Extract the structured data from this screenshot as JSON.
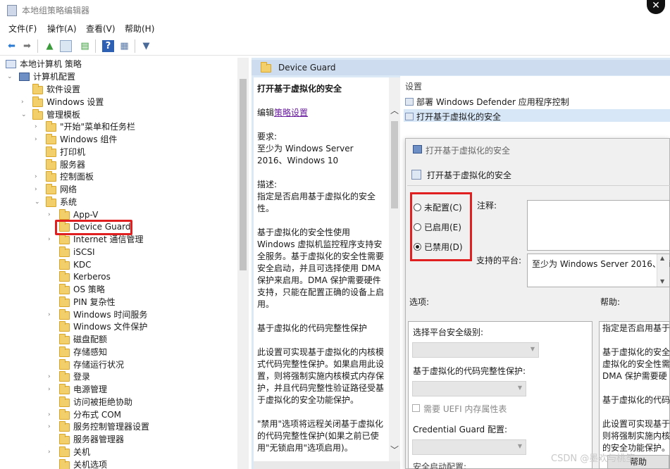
{
  "window": {
    "title": "本地组策略编辑器",
    "close_glyph": "✕"
  },
  "menu": [
    "文件(F)",
    "操作(A)",
    "查看(V)",
    "帮助(H)"
  ],
  "tree": {
    "root": "本地计算机 策略",
    "computer_config": "计算机配置",
    "items": [
      {
        "label": "软件设置"
      },
      {
        "label": "Windows 设置"
      },
      {
        "label": "管理模板"
      },
      {
        "label": "\"开始\"菜单和任务栏"
      },
      {
        "label": "Windows 组件"
      },
      {
        "label": "打印机"
      },
      {
        "label": "服务器"
      },
      {
        "label": "控制面板"
      },
      {
        "label": "网络"
      },
      {
        "label": "系统"
      },
      {
        "label": "App-V"
      },
      {
        "label": "Device Guard"
      },
      {
        "label": "Internet 通信管理"
      },
      {
        "label": "iSCSI"
      },
      {
        "label": "KDC"
      },
      {
        "label": "Kerberos"
      },
      {
        "label": "OS 策略"
      },
      {
        "label": "PIN 复杂性"
      },
      {
        "label": "Windows 时间服务"
      },
      {
        "label": "Windows 文件保护"
      },
      {
        "label": "磁盘配额"
      },
      {
        "label": "存储感知"
      },
      {
        "label": "存储运行状况"
      },
      {
        "label": "登录"
      },
      {
        "label": "电源管理"
      },
      {
        "label": "访问被拒绝协助"
      },
      {
        "label": "分布式 COM"
      },
      {
        "label": "服务控制管理器设置"
      },
      {
        "label": "服务器管理器"
      },
      {
        "label": "关机"
      },
      {
        "label": "关机选项"
      }
    ]
  },
  "right_panel": {
    "folder_title": "Device Guard",
    "description": {
      "heading": "打开基于虚拟化的安全",
      "edit_prefix": "编辑",
      "edit_link": "策略设置",
      "req_label": "要求:",
      "req_text": "至少为 Windows Server 2016、Windows 10",
      "desc_label": "描述:",
      "desc_text": "指定是否启用基于虚拟化的安全性。",
      "para1": "基于虚拟化的安全性使用 Windows 虚拟机监控程序支持安全服务。基于虚拟化的安全性需要安全启动，并且可选择使用 DMA 保护来启用。DMA 保护需要硬件支持，只能在配置正确的设备上启用。",
      "para2": "基于虚拟化的代码完整性保护",
      "para3": "此设置可实现基于虚拟化的内核模式代码完整性保护。如果启用此设置，则将强制实施内核模式内存保护，并且代码完整性验证路径受基于虚拟化的安全功能保护。",
      "para4": "\"禁用\"选项将远程关闭基于虚拟化的代码完整性保护(如果之前已使用\"无锁启用\"选项启用)。"
    },
    "settings": {
      "header": "设置",
      "items": [
        "部署 Windows Defender 应用程序控制",
        "打开基于虚拟化的安全"
      ]
    }
  },
  "dialog": {
    "title": "打开基于虚拟化的安全",
    "subtitle": "打开基于虚拟化的安全",
    "radios": [
      {
        "label": "未配置(C)",
        "checked": false
      },
      {
        "label": "已启用(E)",
        "checked": false
      },
      {
        "label": "已禁用(D)",
        "checked": true
      }
    ],
    "comment_label": "注释:",
    "platform_label": "支持的平台:",
    "platform_value": "至少为 Windows Server 2016、Windows 10",
    "options_label": "选项:",
    "help_label": "帮助:",
    "options": {
      "platform_level": "选择平台安全级别:",
      "code_integrity": "基于虚拟化的代码完整性保护:",
      "uefi": "需要 UEFI 内存属性表",
      "credential_guard": "Credential Guard 配置:",
      "secure_launch": "安全启动配置:"
    },
    "help": {
      "line1": "指定是否启用基于",
      "line2": "基于虚拟化的安全",
      "line3": "虚拟化的安全性需",
      "line4": "DMA 保护需要硬",
      "line5": "基于虚拟化的代码",
      "line6": "此设置可实现基于",
      "line7": "则将强制实施内核",
      "line8": "的安全功能保护。"
    },
    "bottom_button": "帮助"
  },
  "watermark": "CSDN @墨欢与桃笙"
}
